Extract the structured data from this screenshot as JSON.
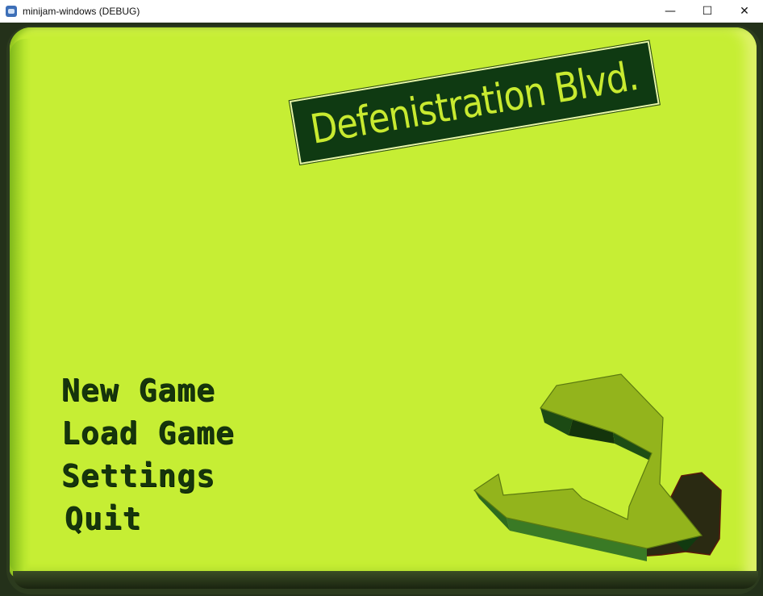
{
  "window": {
    "title": "minijam-windows (DEBUG)",
    "controls": {
      "minimize": "—",
      "maximize": "☐",
      "close": "✕"
    }
  },
  "logo": {
    "text": "Defenistration Blvd."
  },
  "menu": {
    "items": [
      {
        "label": "New Game"
      },
      {
        "label": "Load Game"
      },
      {
        "label": "Settings"
      },
      {
        "label": "Quit"
      }
    ]
  },
  "colors": {
    "screen": "#c6ee34",
    "menu_text": "#16350c",
    "sign_bg": "#0f3a12",
    "sign_text": "#c8ea30"
  },
  "icons": {
    "app": "godot-app-icon",
    "decoration": "bent-arrow-icon"
  }
}
